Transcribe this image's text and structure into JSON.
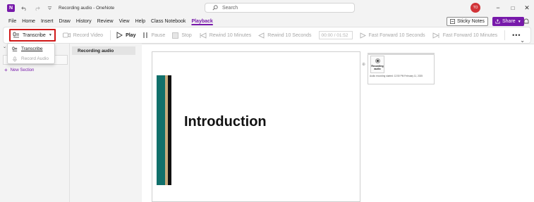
{
  "titlebar": {
    "title": "Recording audio - OneNote",
    "search_placeholder": "Search",
    "avatar_initials": "TO",
    "app_icon_letter": "N",
    "minimize": "−",
    "maximize": "□",
    "close": "✕"
  },
  "menu": {
    "items": [
      "File",
      "Home",
      "Insert",
      "Draw",
      "History",
      "Review",
      "View",
      "Help",
      "Class Notebook",
      "Playback"
    ],
    "active": "Playback",
    "sticky_notes": "Sticky Notes",
    "share": "Share"
  },
  "ribbon": {
    "transcribe": "Transcribe",
    "record_video": "Record Video",
    "play": "Play",
    "pause": "Pause",
    "stop": "Stop",
    "rewind_10_min": "Rewind 10 Minutes",
    "rewind_10_sec": "Rewind 10 Seconds",
    "time": "00:00 / 01:52",
    "ff_10_sec": "Fast Forward 10 Seconds",
    "ff_10_min": "Fast Forward 10 Minutes",
    "more": "•••"
  },
  "dropdown": {
    "transcribe": "Transcribe",
    "record_audio": "Record Audio"
  },
  "sections": {
    "new_section": "New Section"
  },
  "pages": {
    "current": "Recording audio"
  },
  "slide": {
    "title": "Introduction"
  },
  "audio_note": {
    "label_line1": "Recording",
    "label_line2": "audio",
    "caption": "Audio recording started: 12:50 PM February 11, 2025"
  },
  "colors": {
    "accent": "#7719aa",
    "highlight_border": "#d01818",
    "slide_teal": "#11706b",
    "slide_tan": "#c7ab7d"
  }
}
